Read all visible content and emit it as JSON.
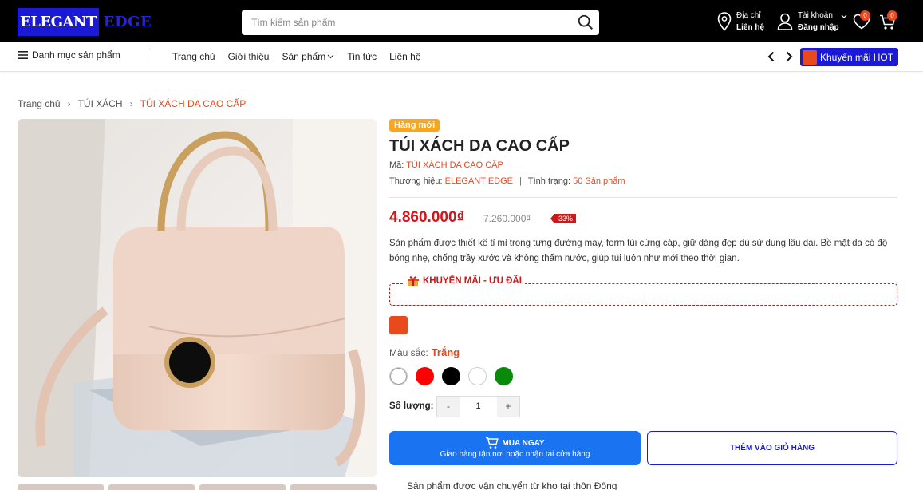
{
  "header": {
    "logo_part1": "ELEGANT",
    "logo_part2": "EDGE",
    "search_placeholder": "Tìm kiếm sản phẩm",
    "address_label": "Địa chỉ",
    "address_value": "Liên hệ",
    "account_label": "Tài khoản",
    "account_value": "Đăng nhập",
    "wishlist_count": "0",
    "cart_count": "0"
  },
  "nav": {
    "category_label": "Danh mục sản phẩm",
    "links": [
      "Trang chủ",
      "Giới thiệu",
      "Sản phẩm",
      "Tin tức",
      "Liên hệ"
    ],
    "promo_label": "Khuyến mãi HOT"
  },
  "breadcrumb": [
    "Trang chủ",
    "TÚI XÁCH",
    "TÚI XÁCH DA CAO CẤP"
  ],
  "product": {
    "badge": "Hàng mới",
    "title": "TÚI XÁCH DA CAO CẤP",
    "code_label": "Mã:",
    "code_value": "TÚI XÁCH DA CAO CẤP",
    "brand_label": "Thương hiệu:",
    "brand_value": "ELEGANT EDGE",
    "status_label": "Tình trạng:",
    "status_value": "50 Sản phẩm",
    "price": "4.860.000₫",
    "old_price": "7.260.000₫",
    "discount": "-33%",
    "description": "Sản phẩm được thiết kế tỉ mỉ trong từng đường may, form túi cứng cáp, giữ dáng đẹp dù sử dụng lâu dài. Bề mặt da có độ bóng nhẹ, chống trầy xước và không thấm nước, giúp túi luôn như mới theo thời gian.",
    "promo_title": "KHUYẾN MÃI - ƯU ĐÃI",
    "selected_swatch_color": "#e8491d",
    "color_label": "Màu sắc:",
    "color_value": "Trắng",
    "colors": [
      "#ffffff",
      "#ff0000",
      "#000000",
      "#ffffff",
      "#0a8a0a"
    ],
    "quantity_label": "Số lượng:",
    "quantity": "1",
    "minus": "-",
    "plus": "+",
    "buy_now": "MUA NGAY",
    "buy_now_sub": "Giao hàng tận nơi hoặc nhận tại cửa hàng",
    "add_to_cart": "THÊM VÀO GIỎ HÀNG",
    "shipping_note": "Sản phẩm được vận chuyển từ kho tại thôn Đông"
  },
  "colors": {
    "brand_blue": "#1a1ad6",
    "accent_orange": "#e8491d",
    "price_red": "#d0161c",
    "buy_blue": "#1a73f0"
  }
}
